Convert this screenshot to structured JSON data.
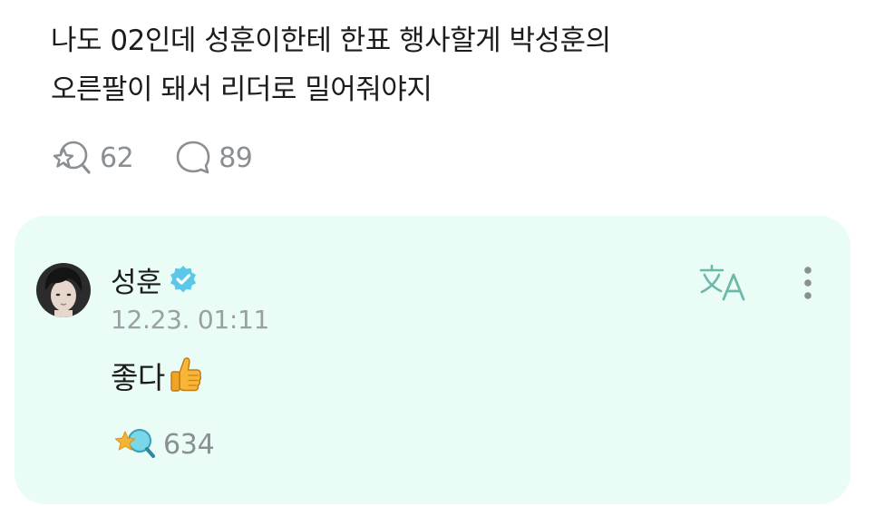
{
  "post": {
    "lines": [
      "나도 02인데 성훈이한테 한표 행사할게 박성훈의",
      "오른팔이 돼서 리더로 밀어줘야지"
    ],
    "like_count": "62",
    "comment_count": "89"
  },
  "reply": {
    "author": "성훈",
    "timestamp": "12.23. 01:11",
    "body": "좋다",
    "body_emoji": "thumbs-up",
    "like_count": "634"
  },
  "icons": {
    "like": "sparkle-magnifier-icon",
    "comment": "speech-bubble-icon",
    "verified": "verified-badge-icon",
    "translate": "translate-icon",
    "more": "vertical-ellipsis-icon"
  },
  "colors": {
    "card_background": "#e9fcf6",
    "verified_badge": "#5cc8e8",
    "muted_text": "#8a8f94",
    "star_accent": "#f2b53a"
  }
}
